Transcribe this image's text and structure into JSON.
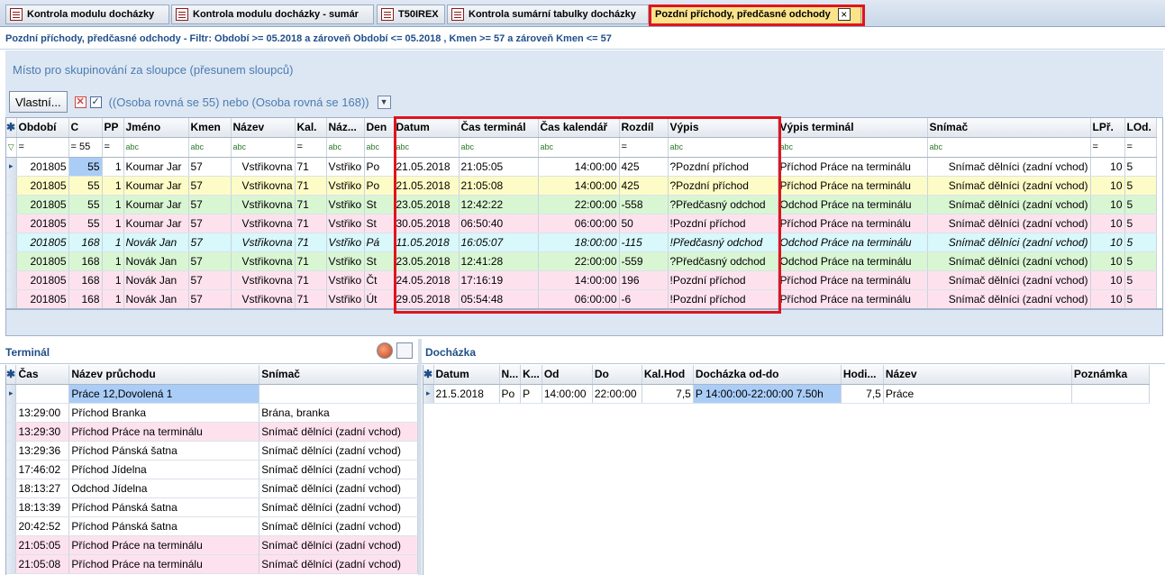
{
  "tabs": [
    {
      "label": "Kontrola modulu docházky"
    },
    {
      "label": "Kontrola modulu docházky - sumár"
    },
    {
      "label": "T50IREX"
    },
    {
      "label": "Kontrola sumární tabulky docházky"
    },
    {
      "label": "Pozdní příchody, předčasné odchody"
    }
  ],
  "tab_close": "×",
  "filter_line": "Pozdní příchody, předčasné odchody   -  Filtr: Období >= 05.2018  a zároveň  Období <= 05.2018 ,  Kmen >= 57  a zároveň  Kmen <= 57",
  "group_area": "Místo pro skupinování za sloupce (přesunem sloupců)",
  "filter_bar": {
    "custom_button": "Vlastní...",
    "expression": "((Osoba rovná se 55) nebo (Osoba rovná se 168))",
    "x_mark": "✕",
    "check_mark": "✓"
  },
  "top_grid": {
    "headers": [
      "Období",
      "C",
      "PP",
      "Jméno",
      "Kmen",
      "Název",
      "Kal.",
      "Náz...",
      "Den",
      "Datum",
      "Čas terminál",
      "Čas kalendář",
      "Rozdíl",
      "Výpis",
      "Výpis terminál",
      "Snímač",
      "LPř.",
      "LOd."
    ],
    "filters": [
      "=",
      "= 55",
      "=",
      "abc",
      "abc",
      "abc",
      "=",
      "abc",
      "abc",
      "abc",
      "abc",
      "abc",
      "=",
      "abc",
      "abc",
      "abc",
      "=",
      "="
    ],
    "rows": [
      {
        "style": "white",
        "cells": [
          "201805",
          "55",
          "1",
          "Koumar Jar",
          "57",
          "Vstřikovna",
          "71",
          "Vstřiko",
          "Po",
          "21.05.2018",
          "21:05:05",
          "14:00:00",
          "425",
          "?Pozdní příchod",
          "Příchod Práce na terminálu",
          "Snímač dělníci (zadní vchod)",
          "10",
          "5"
        ]
      },
      {
        "style": "yellow",
        "cells": [
          "201805",
          "55",
          "1",
          "Koumar Jar",
          "57",
          "Vstřikovna",
          "71",
          "Vstřiko",
          "Po",
          "21.05.2018",
          "21:05:08",
          "14:00:00",
          "425",
          "?Pozdní příchod",
          "Příchod Práce na terminálu",
          "Snímač dělníci (zadní vchod)",
          "10",
          "5"
        ]
      },
      {
        "style": "green",
        "cells": [
          "201805",
          "55",
          "1",
          "Koumar Jar",
          "57",
          "Vstřikovna",
          "71",
          "Vstřiko",
          "St",
          "23.05.2018",
          "12:42:22",
          "22:00:00",
          "-558",
          "?Předčasný odchod",
          "Odchod Práce na terminálu",
          "Snímač dělníci (zadní vchod)",
          "10",
          "5"
        ]
      },
      {
        "style": "pink",
        "cells": [
          "201805",
          "55",
          "1",
          "Koumar Jar",
          "57",
          "Vstřikovna",
          "71",
          "Vstřiko",
          "St",
          "30.05.2018",
          "06:50:40",
          "06:00:00",
          "50",
          "!Pozdní příchod",
          "Příchod Práce na terminálu",
          "Snímač dělníci (zadní vchod)",
          "10",
          "5"
        ]
      },
      {
        "style": "cyan",
        "cells": [
          "201805",
          "168",
          "1",
          "Novák Jan",
          "57",
          "Vstřikovna",
          "71",
          "Vstřiko",
          "Pá",
          "11.05.2018",
          "16:05:07",
          "18:00:00",
          "-115",
          "!Předčasný odchod",
          "Odchod Práce na terminálu",
          "Snímač dělníci (zadní vchod)",
          "10",
          "5"
        ]
      },
      {
        "style": "green",
        "cells": [
          "201805",
          "168",
          "1",
          "Novák Jan",
          "57",
          "Vstřikovna",
          "71",
          "Vstřiko",
          "St",
          "23.05.2018",
          "12:41:28",
          "22:00:00",
          "-559",
          "?Předčasný odchod",
          "Odchod Práce na terminálu",
          "Snímač dělníci (zadní vchod)",
          "10",
          "5"
        ]
      },
      {
        "style": "pink",
        "cells": [
          "201805",
          "168",
          "1",
          "Novák Jan",
          "57",
          "Vstřikovna",
          "71",
          "Vstřiko",
          "Čt",
          "24.05.2018",
          "17:16:19",
          "14:00:00",
          "196",
          "!Pozdní příchod",
          "Příchod Práce na terminálu",
          "Snímač dělníci (zadní vchod)",
          "10",
          "5"
        ]
      },
      {
        "style": "pink",
        "cells": [
          "201805",
          "168",
          "1",
          "Novák Jan",
          "57",
          "Vstřikovna",
          "71",
          "Vstřiko",
          "Út",
          "29.05.2018",
          "05:54:48",
          "06:00:00",
          "-6",
          "!Pozdní příchod",
          "Příchod Práce na terminálu",
          "Snímač dělníci (zadní vchod)",
          "10",
          "5"
        ]
      }
    ]
  },
  "terminal": {
    "title": "Terminál",
    "headers": [
      "Čas",
      "Název průchodu",
      "Snímač"
    ],
    "rows": [
      {
        "style": "white",
        "cells": [
          "",
          "Práce 12,Dovolená 1",
          ""
        ]
      },
      {
        "style": "white",
        "cells": [
          "13:29:00",
          "Příchod Branka",
          "Brána, branka"
        ]
      },
      {
        "style": "pink",
        "cells": [
          "13:29:30",
          "Příchod Práce na terminálu",
          "Snímač dělníci (zadní vchod)"
        ]
      },
      {
        "style": "white",
        "cells": [
          "13:29:36",
          "Příchod Pánská šatna",
          "Snímač dělníci (zadní vchod)"
        ]
      },
      {
        "style": "white",
        "cells": [
          "17:46:02",
          "Příchod Jídelna",
          "Snímač dělníci (zadní vchod)"
        ]
      },
      {
        "style": "white",
        "cells": [
          "18:13:27",
          "Odchod Jídelna",
          "Snímač dělníci (zadní vchod)"
        ]
      },
      {
        "style": "white",
        "cells": [
          "18:13:39",
          "Příchod Pánská šatna",
          "Snímač dělníci (zadní vchod)"
        ]
      },
      {
        "style": "white",
        "cells": [
          "20:42:52",
          "Příchod Pánská šatna",
          "Snímač dělníci (zadní vchod)"
        ]
      },
      {
        "style": "pink",
        "cells": [
          "21:05:05",
          "Příchod Práce na terminálu",
          "Snímač dělníci (zadní vchod)"
        ]
      },
      {
        "style": "pink",
        "cells": [
          "21:05:08",
          "Příchod Práce na terminálu",
          "Snímač dělníci (zadní vchod)"
        ]
      }
    ]
  },
  "dochazka": {
    "title": "Docházka",
    "headers": [
      "Datum",
      "N...",
      "K...",
      "Od",
      "Do",
      "Kal.Hod",
      "Docházka od-do",
      "Hodi...",
      "Název",
      "Poznámka"
    ],
    "rows": [
      {
        "style": "white",
        "cells": [
          "21.5.2018",
          "Po",
          "P",
          "14:00:00",
          "22:00:00",
          "7,5",
          "P 14:00:00-22:00:00 7.50h",
          "7,5",
          "Práce",
          ""
        ]
      }
    ]
  },
  "colors": {
    "accent": "#1f4f8a",
    "active_tab": "#fbe38a",
    "highlight": "#e0141e"
  }
}
